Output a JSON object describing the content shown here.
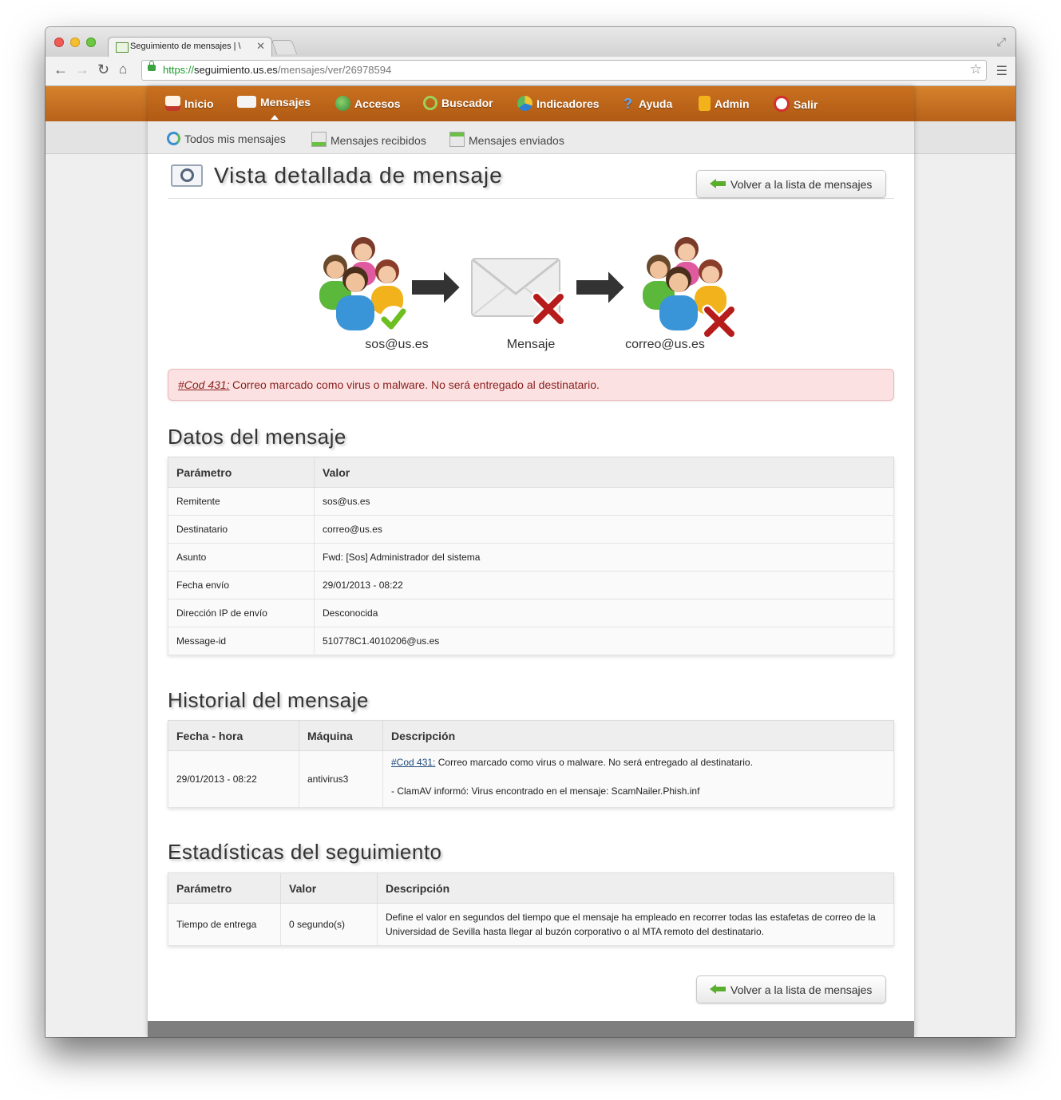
{
  "browser": {
    "tab_title": "Seguimiento de mensajes | \\",
    "url_scheme": "https://",
    "url_host": "seguimiento.us.es",
    "url_path": "/mensajes/ver/26978594"
  },
  "nav": {
    "items": [
      {
        "label": "Inicio",
        "icon": "home-icon",
        "color": "#c0392b"
      },
      {
        "label": "Mensajes",
        "icon": "envelope-icon",
        "color": "#ffffff"
      },
      {
        "label": "Accesos",
        "icon": "globe-icon",
        "color": "#4caf50"
      },
      {
        "label": "Buscador",
        "icon": "magnifier-icon",
        "color": "#7cbf3a"
      },
      {
        "label": "Indicadores",
        "icon": "pie-chart-icon",
        "color": "#2f7fd1"
      },
      {
        "label": "Ayuda",
        "icon": "question-icon",
        "color": "#2a6fd0"
      },
      {
        "label": "Admin",
        "icon": "padlock-icon",
        "color": "#f2b21b"
      },
      {
        "label": "Salir",
        "icon": "power-icon",
        "color": "#d32f2f"
      }
    ]
  },
  "subnav": {
    "items": [
      {
        "label": "Todos mis mensajes",
        "icon": "refresh-icon"
      },
      {
        "label": "Mensajes recibidos",
        "icon": "inbox-down-icon"
      },
      {
        "label": "Mensajes enviados",
        "icon": "inbox-up-icon"
      }
    ]
  },
  "page": {
    "title": "Vista detallada de mensaje",
    "back_button": "Volver a la lista de mensajes"
  },
  "diagram": {
    "sender": "sos@us.es",
    "message": "Mensaje",
    "recipient": "correo@us.es"
  },
  "alert": {
    "code": "#Cod 431:",
    "message": "Correo marcado como virus o malware. No será entregado al destinatario."
  },
  "datos": {
    "title": "Datos del mensaje",
    "headers": [
      "Parámetro",
      "Valor"
    ],
    "rows": [
      [
        "Remitente",
        "sos@us.es"
      ],
      [
        "Destinatario",
        "correo@us.es"
      ],
      [
        "Asunto",
        "Fwd: [Sos] Administrador del sistema"
      ],
      [
        "Fecha envío",
        "29/01/2013 - 08:22"
      ],
      [
        "Dirección IP de envío",
        "Desconocida"
      ],
      [
        "Message-id",
        "510778C1.4010206@us.es"
      ]
    ]
  },
  "historial": {
    "title": "Historial del mensaje",
    "headers": [
      "Fecha - hora",
      "Máquina",
      "Descripción"
    ],
    "rows": [
      {
        "fecha": "29/01/2013 - 08:22",
        "maquina": "antivirus3",
        "code": "#Cod 431:",
        "desc": "Correo marcado como virus o malware. No será entregado al destinatario.",
        "detail": "- ClamAV informó: Virus encontrado en el mensaje: ScamNailer.Phish.inf"
      }
    ]
  },
  "estadisticas": {
    "title": "Estadísticas del seguimiento",
    "headers": [
      "Parámetro",
      "Valor",
      "Descripción"
    ],
    "rows": [
      [
        "Tiempo de entrega",
        "0 segundo(s)",
        "Define el valor en segundos del tiempo que el mensaje ha empleado en recorrer todas las estafetas de correo de la Universidad de Sevilla hasta llegar al buzón corporativo o al MTA remoto del destinatario."
      ]
    ]
  },
  "colors": {
    "nav_orange": "#c9701f",
    "alert_bg": "#fbe1e1",
    "alert_text": "#8a1f1f"
  }
}
